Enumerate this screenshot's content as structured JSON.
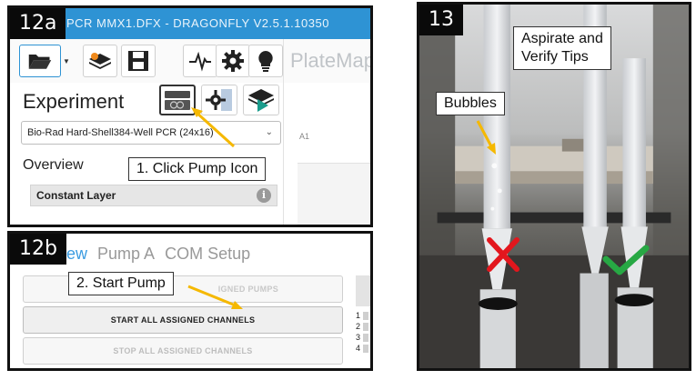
{
  "panels": {
    "p12a": {
      "badge": "12a",
      "title": "PCR MMX1.DFX - DRAGONFLY V2.5.1.10350",
      "platemap_label": "PlateMap",
      "experiment_label": "Experiment",
      "plate_type": "Bio-Rad Hard-Shell384-Well PCR  (24x16)",
      "overview_label": "Overview",
      "layer_label": "Constant Layer",
      "well_label": "A1",
      "callout": "1. Click Pump Icon"
    },
    "p12b": {
      "badge": "12b",
      "tabs": [
        "ew",
        "Pump A",
        "COM Setup"
      ],
      "assigned_pumps_label": "IGNED PUMPS",
      "start_label": "START ALL ASSIGNED CHANNELS",
      "stop_label": "STOP ALL ASSIGNED CHANNELS",
      "channels": [
        "1",
        "2",
        "3",
        "4"
      ],
      "callout": "2. Start Pump"
    },
    "p13": {
      "badge": "13",
      "callout_main": "Aspirate and\nVerify Tips",
      "callout_bubbles": "Bubbles"
    }
  },
  "colors": {
    "titlebar": "#2e93d4",
    "arrow": "#f5b800",
    "cross": "#e3161d",
    "check": "#27a844",
    "active_tab": "#3a9be0"
  },
  "icons": [
    "folder-open-icon",
    "dropdown-arrow-icon",
    "new-layers-icon",
    "save-icon",
    "pulse-icon",
    "gear-icon",
    "lightbulb-icon",
    "pump-icon",
    "settings-icon",
    "run-icon",
    "info-icon",
    "cross-icon",
    "check-icon"
  ]
}
